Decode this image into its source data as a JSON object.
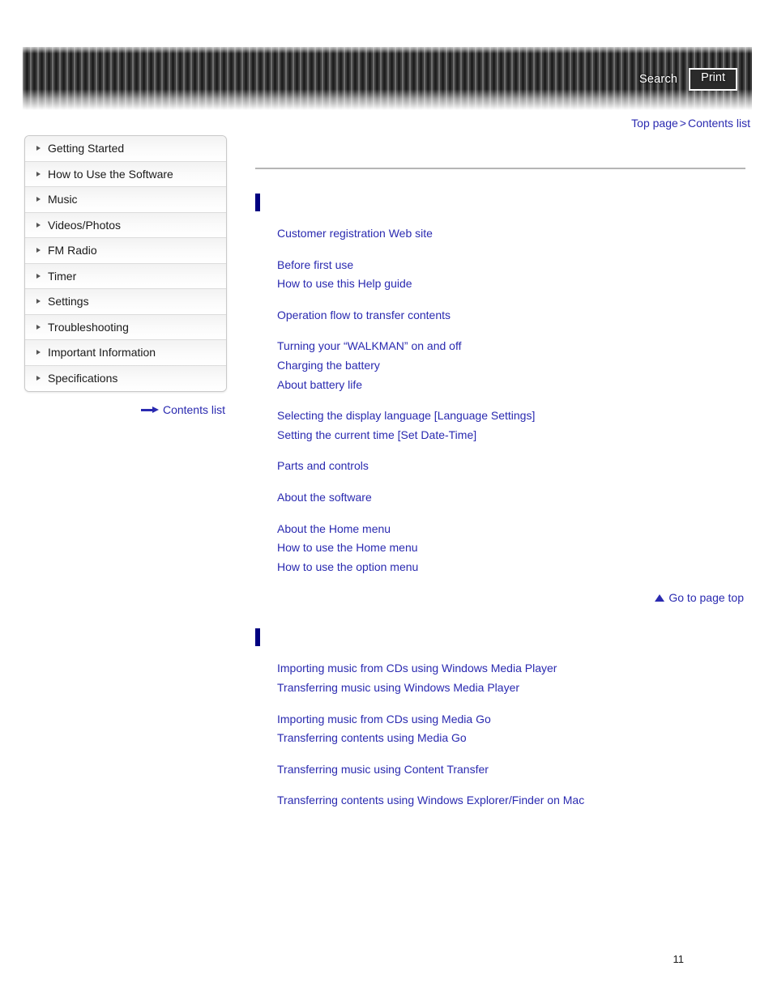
{
  "header": {
    "search_label": "Search",
    "print_label": "Print"
  },
  "breadcrumb": {
    "top_page": "Top page",
    "separator": ">",
    "current": "Contents list"
  },
  "sidebar": {
    "items": [
      {
        "label": "Getting Started"
      },
      {
        "label": "How to Use the Software"
      },
      {
        "label": "Music"
      },
      {
        "label": "Videos/Photos"
      },
      {
        "label": "FM Radio"
      },
      {
        "label": "Timer"
      },
      {
        "label": "Settings"
      },
      {
        "label": "Troubleshooting"
      },
      {
        "label": "Important Information"
      },
      {
        "label": "Specifications"
      }
    ],
    "contents_list_label": "Contents list"
  },
  "main": {
    "page_top_label": "Go to page top",
    "sections": [
      {
        "title": "",
        "groups": [
          {
            "title": "",
            "links": [
              "Customer registration Web site"
            ]
          },
          {
            "title": "",
            "links": [
              "Before first use",
              "How to use this Help guide"
            ]
          },
          {
            "title": "",
            "links": [
              "Operation flow to transfer contents"
            ]
          },
          {
            "title": "",
            "links": [
              "Turning your “WALKMAN” on and off",
              "Charging the battery",
              "About battery life"
            ]
          },
          {
            "title": "",
            "links": [
              "Selecting the display language [Language Settings]",
              "Setting the current time [Set Date-Time]"
            ]
          },
          {
            "title": "",
            "links": [
              "Parts and controls"
            ]
          },
          {
            "title": "",
            "links": [
              "About the software"
            ]
          },
          {
            "title": "",
            "links": [
              "About the Home menu",
              "How to use the Home menu",
              "How to use the option menu"
            ]
          }
        ]
      },
      {
        "title": "",
        "groups": [
          {
            "title": "",
            "links": [
              "Importing music from CDs using Windows Media Player",
              "Transferring music using Windows Media Player"
            ]
          },
          {
            "title": "",
            "links": [
              "Importing music from CDs using Media Go",
              "Transferring contents using Media Go"
            ]
          },
          {
            "title": "",
            "links": [
              "Transferring music using Content Transfer"
            ]
          },
          {
            "title": "",
            "links": [
              "Transferring contents using Windows Explorer/Finder on Mac"
            ]
          }
        ]
      }
    ]
  },
  "footer": {
    "page_number": "11"
  }
}
